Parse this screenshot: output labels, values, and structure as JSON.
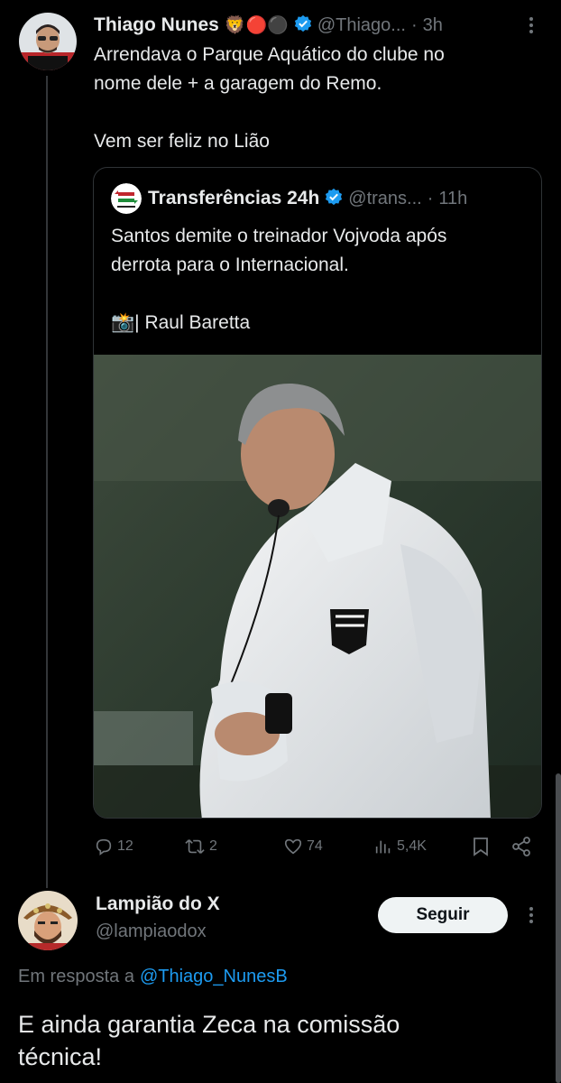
{
  "tweet": {
    "author_name": "Thiago Nunes",
    "author_emojis": "🦁🔴⚫",
    "handle": "@Thiago...",
    "dot": "·",
    "time": "3h",
    "text_line1": "Arrendava o Parque Aquático do clube no",
    "text_line2": "nome dele + a garagem do Remo.",
    "text_line3": "Vem ser feliz no Lião"
  },
  "quote": {
    "author_name": "Transferências 24h",
    "handle": "@trans...",
    "dot": "·",
    "time": "11h",
    "text_line1": "Santos demite o treinador Vojvoda após",
    "text_line2": "derrota para o Internacional.",
    "credit_emoji": "📸",
    "credit_text": "| Raul Baretta"
  },
  "actions": {
    "replies": "12",
    "retweets": "2",
    "likes": "74",
    "views": "5,4K"
  },
  "reply": {
    "author_name": "Lampião do X",
    "handle": "@lampiaodox",
    "follow_label": "Seguir",
    "in_reply_prefix": "Em resposta a",
    "in_reply_handle": "@Thiago_NunesB",
    "text_line1": "E ainda garantia Zeca na comissão",
    "text_line2": "técnica!"
  },
  "colors": {
    "background": "#000000",
    "text": "#e7e9ea",
    "muted": "#71767b",
    "link": "#1d9bf0",
    "verified": "#1d9bf0"
  }
}
